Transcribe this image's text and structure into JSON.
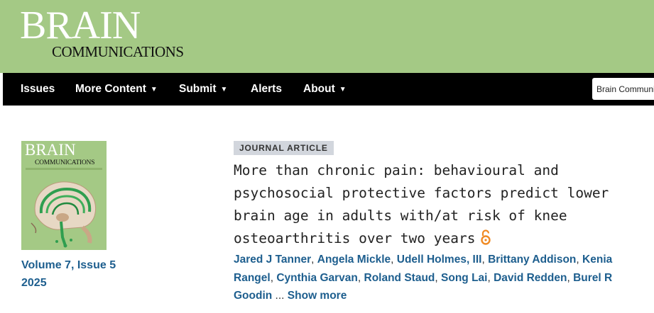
{
  "header": {
    "logo_main": "BRAIN",
    "logo_sub": "COMMUNICATIONS"
  },
  "nav": {
    "items": [
      {
        "label": "Issues",
        "dropdown": false
      },
      {
        "label": "More Content",
        "dropdown": true
      },
      {
        "label": "Submit",
        "dropdown": true
      },
      {
        "label": "Alerts",
        "dropdown": false
      },
      {
        "label": "About",
        "dropdown": true
      }
    ],
    "caret": "▼",
    "search_value": "Brain Communications"
  },
  "cover": {
    "brain": "BRAIN",
    "communications": "COMMUNICATIONS"
  },
  "issue": {
    "volume": "Volume 7, Issue 5",
    "year": "2025"
  },
  "article": {
    "type": "JOURNAL ARTICLE",
    "title": "More than chronic pain: behavioural and psychosocial protective factors predict lower brain age in adults with/at risk of knee osteoarthritis over two years",
    "open_access_icon": "open-lock-icon",
    "authors": [
      "Jared J Tanner",
      "Angela Mickle",
      "Udell Holmes, III",
      "Brittany Addison",
      "Kenia Rangel",
      "Cynthia Garvan",
      "Roland Staud",
      "Song Lai",
      "David Redden",
      "Burel R Goodin"
    ],
    "separator": ", ",
    "ellipsis": " ... ",
    "show_more": "Show more"
  },
  "colors": {
    "header_green": "#a4c985",
    "nav_black": "#000000",
    "link_blue": "#1d5e8e",
    "badge_gray": "#d2d6dd",
    "open_access_orange": "#f08a24"
  }
}
